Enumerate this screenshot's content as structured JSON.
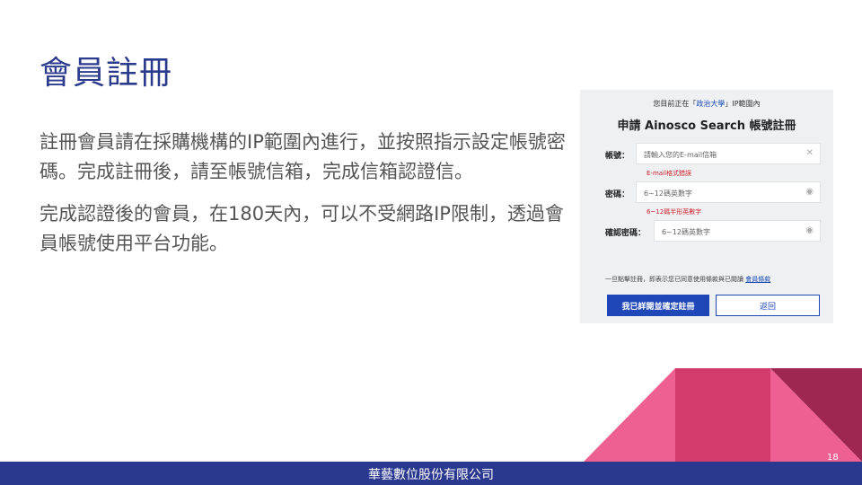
{
  "slide": {
    "title": "會員註冊",
    "paragraphs": [
      "註冊會員請在採購機構的IP範圍內進行，並按照指示設定帳號密碼。完成註冊後，請至帳號信箱，完成信箱認證信。",
      "完成認證後的會員，在180天內，可以不受網路IP限制，透過會員帳號使用平台功能。"
    ],
    "page_number": "18",
    "footer_company": "華藝數位股份有限公司"
  },
  "form": {
    "notice_prefix": "您目前正在「",
    "notice_institution": "政治大學",
    "notice_suffix": "」IP範圍內",
    "title": "申請 Ainosco Search 帳號註冊",
    "account": {
      "label": "帳號：",
      "placeholder": "請輸入您的E-mail信箱",
      "error": "E-mail格式錯誤",
      "clear_icon": "close-icon"
    },
    "password": {
      "label": "密碼：",
      "placeholder": "6~12碼英數字",
      "error": "6~12碼半形英數字",
      "toggle_icon": "eye-icon"
    },
    "confirm": {
      "label": "確認密碼：",
      "placeholder": "6~12碼英數字",
      "toggle_icon": "eye-icon"
    },
    "agreement_text": "一旦點擊註冊，即表示您已同意使用條款與已閱讀",
    "agreement_link": "會員條款",
    "submit_label": "我已詳閱並確定註冊",
    "back_label": "返回"
  },
  "colors": {
    "title": "#2a3a8c",
    "footer": "#2b388f",
    "primary_button": "#1f47b8",
    "error": "#d0262e",
    "deco_pink": "#ee5f92",
    "deco_crimson": "#d13c6c",
    "deco_maroon": "#9e2650"
  }
}
